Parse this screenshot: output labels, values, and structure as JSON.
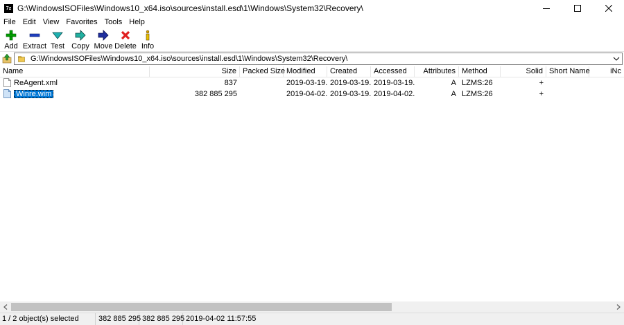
{
  "window": {
    "app_icon_text": "7z",
    "title": "G:\\WindowsISOFiles\\Windows10_x64.iso\\sources\\install.esd\\1\\Windows\\System32\\Recovery\\"
  },
  "menu": [
    "File",
    "Edit",
    "View",
    "Favorites",
    "Tools",
    "Help"
  ],
  "toolbar": {
    "add": "Add",
    "extract": "Extract",
    "test": "Test",
    "copy": "Copy",
    "move": "Move",
    "delete": "Delete",
    "info": "Info"
  },
  "address": {
    "path": "G:\\WindowsISOFiles\\Windows10_x64.iso\\sources\\install.esd\\1\\Windows\\System32\\Recovery\\"
  },
  "columns": {
    "name": "Name",
    "size": "Size",
    "packed_size": "Packed Size",
    "modified": "Modified",
    "created": "Created",
    "accessed": "Accessed",
    "attributes": "Attributes",
    "method": "Method",
    "solid": "Solid",
    "short_name": "Short Name",
    "inode": "iNc"
  },
  "files": [
    {
      "name": "ReAgent.xml",
      "size": "837",
      "packed_size": "",
      "modified": "2019-03-19...",
      "created": "2019-03-19...",
      "accessed": "2019-03-19...",
      "attributes": "A",
      "method": "LZMS:26",
      "solid": "+",
      "selected": false
    },
    {
      "name": "Winre.wim",
      "size": "382 885 295",
      "packed_size": "",
      "modified": "2019-04-02...",
      "created": "2019-03-19...",
      "accessed": "2019-04-02...",
      "attributes": "A",
      "method": "LZMS:26",
      "solid": "+",
      "selected": true
    }
  ],
  "status": {
    "selection": "1 / 2 object(s) selected",
    "size": "382 885 295",
    "packed": "382 885 295",
    "modified": "2019-04-02 11:57:55"
  },
  "colors": {
    "selection": "#0078d7",
    "add_icon": "#00a000",
    "extract_icon": "#1f3fbf",
    "test_icon": "#20b0b0",
    "delete_icon": "#e02020"
  }
}
